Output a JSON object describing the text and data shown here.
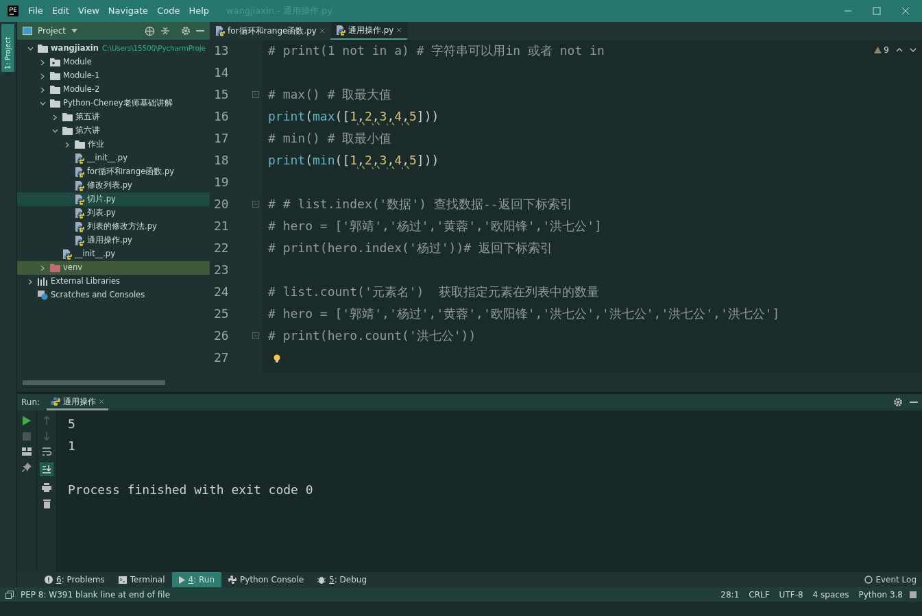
{
  "menu": [
    "File",
    "Edit",
    "View",
    "Navigate",
    "Code",
    "Help"
  ],
  "window": {
    "title": "wangjiaxin - 通用操作.py"
  },
  "side_strip": {
    "label": "1: Project"
  },
  "project_panel": {
    "title": "Project"
  },
  "editor_tabs": [
    {
      "label": "for循环和range函数.py",
      "selected": false
    },
    {
      "label": "通用操作.py",
      "selected": true
    }
  ],
  "tree": [
    {
      "label": "wangjiaxin",
      "path": "C:\\Users\\15500\\PycharmProje",
      "kind": "folder",
      "expanded": true,
      "selected": false,
      "children": [
        {
          "label": "Module",
          "kind": "module",
          "expanded": false,
          "selected": false
        },
        {
          "label": "Module-1",
          "kind": "folder",
          "expanded": false,
          "selected": false
        },
        {
          "label": "Module-2",
          "kind": "folder",
          "expanded": false,
          "selected": false
        },
        {
          "label": "Python-Cheney老师基础讲解",
          "kind": "folder",
          "expanded": true,
          "selected": false,
          "children": [
            {
              "label": "第五讲",
              "kind": "folder",
              "expanded": false,
              "selected": false
            },
            {
              "label": "第六讲",
              "kind": "folder",
              "expanded": true,
              "selected": false,
              "children": [
                {
                  "label": "作业",
                  "kind": "folder",
                  "expanded": false,
                  "selected": false
                },
                {
                  "label": "__init__.py",
                  "kind": "python",
                  "selected": false
                },
                {
                  "label": "for循环和range函数.py",
                  "kind": "python",
                  "selected": false
                },
                {
                  "label": "修改列表.py",
                  "kind": "python",
                  "selected": false
                },
                {
                  "label": "切片.py",
                  "kind": "python",
                  "selected": true
                },
                {
                  "label": "列表.py",
                  "kind": "python",
                  "selected": false
                },
                {
                  "label": "列表的修改方法.py",
                  "kind": "python",
                  "selected": false
                },
                {
                  "label": "通用操作.py",
                  "kind": "python",
                  "selected": false
                }
              ]
            },
            {
              "label": "__init__.py",
              "kind": "python",
              "selected": false
            }
          ]
        },
        {
          "label": "venv",
          "kind": "excluded",
          "expanded": false,
          "selected": false
        }
      ]
    },
    {
      "label": "External Libraries",
      "kind": "libraries",
      "expanded": false,
      "selected": false
    },
    {
      "label": "Scratches and Consoles",
      "kind": "scratches",
      "selected": false
    }
  ],
  "inspection": {
    "count": "9"
  },
  "code_lines": [
    {
      "number": "13",
      "fold": false,
      "tokens": [
        {
          "text": "# print(1 not in a) # 字符串可以用in 或者 not in",
          "kind": "comment"
        }
      ]
    },
    {
      "number": "14",
      "fold": false
    },
    {
      "number": "15",
      "fold": true,
      "tokens": [
        {
          "text": "# max() # 取最大值",
          "kind": "comment"
        }
      ]
    },
    {
      "number": "16",
      "fold": false,
      "tokens": [
        {
          "text": "print",
          "kind": "builtin"
        },
        {
          "text": "(",
          "kind": "punct"
        },
        {
          "text": "max",
          "kind": "builtin"
        },
        {
          "text": "([",
          "kind": "punct"
        },
        {
          "text": "1",
          "kind": "number"
        },
        {
          "text": ",",
          "kind": "warn"
        },
        {
          "text": "2",
          "kind": "number"
        },
        {
          "text": ",",
          "kind": "warn"
        },
        {
          "text": "3",
          "kind": "number"
        },
        {
          "text": ",",
          "kind": "warn"
        },
        {
          "text": "4",
          "kind": "number"
        },
        {
          "text": ",",
          "kind": "warn"
        },
        {
          "text": "5",
          "kind": "number"
        },
        {
          "text": "]))",
          "kind": "punct"
        }
      ]
    },
    {
      "number": "17",
      "fold": false,
      "tokens": [
        {
          "text": "# min() # 取最小值",
          "kind": "comment"
        }
      ]
    },
    {
      "number": "18",
      "fold": false,
      "tokens": [
        {
          "text": "print",
          "kind": "builtin"
        },
        {
          "text": "(",
          "kind": "punct"
        },
        {
          "text": "min",
          "kind": "builtin"
        },
        {
          "text": "([",
          "kind": "punct"
        },
        {
          "text": "1",
          "kind": "number"
        },
        {
          "text": ",",
          "kind": "warn"
        },
        {
          "text": "2",
          "kind": "number"
        },
        {
          "text": ",",
          "kind": "warn"
        },
        {
          "text": "3",
          "kind": "number"
        },
        {
          "text": ",",
          "kind": "warn"
        },
        {
          "text": "4",
          "kind": "number"
        },
        {
          "text": ",",
          "kind": "warn"
        },
        {
          "text": "5",
          "kind": "number"
        },
        {
          "text": "]))",
          "kind": "punct"
        }
      ]
    },
    {
      "number": "19",
      "fold": false
    },
    {
      "number": "20",
      "fold": true,
      "tokens": [
        {
          "text": "# # list.index('数据') 查找数据--返回下标索引",
          "kind": "comment"
        }
      ]
    },
    {
      "number": "21",
      "fold": false,
      "tokens": [
        {
          "text": "# hero = ['郭靖','杨过','黄蓉','欧阳锋','洪七公']",
          "kind": "comment"
        }
      ]
    },
    {
      "number": "22",
      "fold": false,
      "tokens": [
        {
          "text": "# print(hero.index('杨过'))# 返回下标索引",
          "kind": "comment"
        }
      ]
    },
    {
      "number": "23",
      "fold": false
    },
    {
      "number": "24",
      "fold": false,
      "tokens": [
        {
          "text": "# list.count('元素名')  获取指定元素在列表中的数量",
          "kind": "comment"
        }
      ]
    },
    {
      "number": "25",
      "fold": false,
      "tokens": [
        {
          "text": "# hero = ['郭靖','杨过','黄蓉','欧阳锋','洪七公','洪七公','洪七公','洪七公']",
          "kind": "comment"
        }
      ]
    },
    {
      "number": "26",
      "fold": true,
      "tokens": [
        {
          "text": "# print(hero.count('洪七公'))",
          "kind": "comment"
        }
      ]
    },
    {
      "number": "27",
      "fold": false,
      "bulb": true
    }
  ],
  "run_panel": {
    "label": "Run:",
    "tab": "通用操作",
    "output": [
      "5",
      "1",
      "Process finished with exit code 0"
    ]
  },
  "tool_tabs": [
    {
      "mnemonic": "6",
      "label": ": Problems",
      "kind": "problems",
      "selected": false
    },
    {
      "label": "Terminal",
      "kind": "terminal",
      "selected": false
    },
    {
      "mnemonic": "4",
      "label": ": Run",
      "kind": "run",
      "selected": true
    },
    {
      "label": "Python Console",
      "kind": "python",
      "selected": false
    },
    {
      "mnemonic": "5",
      "label": ": Debug",
      "kind": "debug",
      "selected": false
    }
  ],
  "event_log": "Event Log",
  "status_bar": {
    "message": "PEP 8: W391 blank line at end of file",
    "items": [
      "28:1",
      "CRLF",
      "UTF-8",
      "4 spaces",
      "Python 3.8"
    ]
  }
}
